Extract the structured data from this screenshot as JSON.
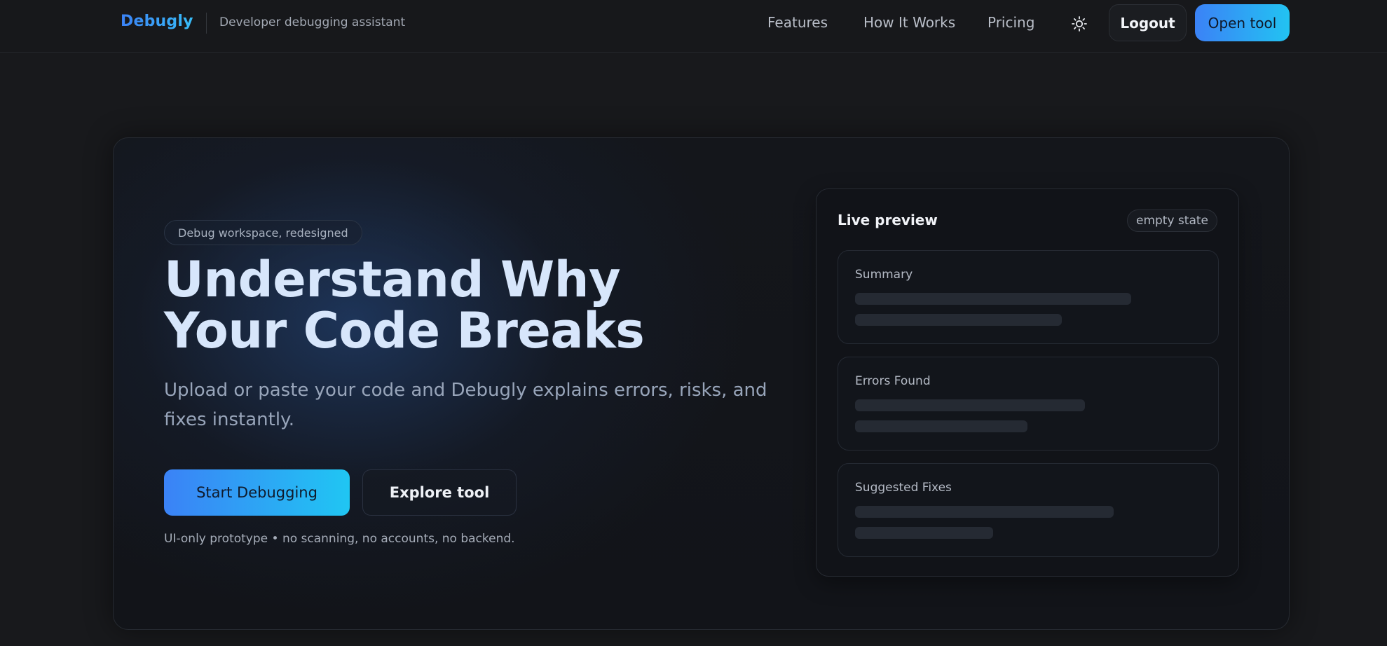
{
  "app": {
    "brand": "Debugly",
    "tagline": "Developer debugging assistant"
  },
  "nav": {
    "links": [
      "Features",
      "How It Works",
      "Pricing"
    ],
    "theme_icon": "sun-icon",
    "logout_label": "Logout",
    "open_tool_label": "Open tool"
  },
  "colors": {
    "accent_start": "#3b82f6",
    "accent_end": "#22c3f2",
    "background": "#18191c",
    "headline": "#d7e6fb"
  },
  "hero": {
    "pill": "Debug workspace, redesigned",
    "headline_line1": "Understand Why",
    "headline_line2": "Your Code Breaks",
    "subhead": "Upload or paste your code and Debugly explains errors, risks, and fixes instantly.",
    "start_label": "Start Debugging",
    "explore_label": "Explore tool",
    "note": "UI-only prototype • no scanning, no accounts, no backend."
  },
  "preview": {
    "title": "Live preview",
    "badge": "empty state",
    "sections": [
      {
        "title": "Summary"
      },
      {
        "title": "Errors Found"
      },
      {
        "title": "Suggested Fixes"
      }
    ]
  }
}
